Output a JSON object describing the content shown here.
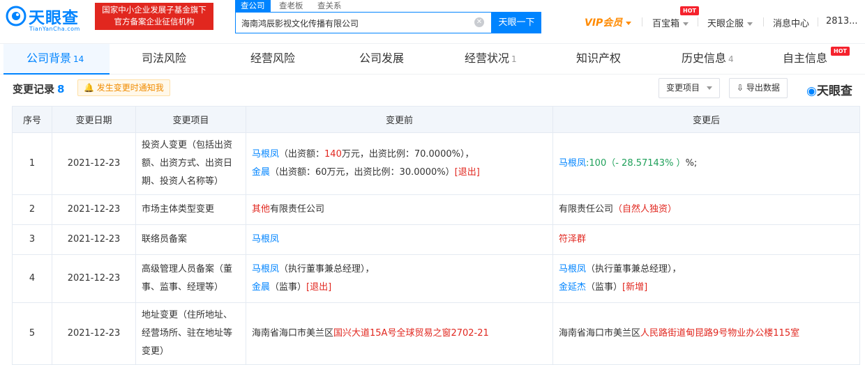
{
  "brand": {
    "name": "天眼查",
    "domain": "TianYanCha.com",
    "accent": "#0084ff"
  },
  "fund_badge": {
    "line1": "国家中小企业发展子基金旗下",
    "line2": "官方备案企业征信机构"
  },
  "search": {
    "tabs": [
      "查公司",
      "查老板",
      "查关系"
    ],
    "value": "海南鸿辰影视文化传播有限公司",
    "button": "天眼一下"
  },
  "nav": {
    "vip": "VIP会员",
    "items": [
      "百宝箱",
      "天眼企服",
      "消息中心",
      "2813..."
    ],
    "hot_label": "HOT"
  },
  "tabs": [
    {
      "label": "公司背景",
      "count": "14"
    },
    {
      "label": "司法风险",
      "count": ""
    },
    {
      "label": "经营风险",
      "count": ""
    },
    {
      "label": "公司发展",
      "count": ""
    },
    {
      "label": "经营状况",
      "count": "1"
    },
    {
      "label": "知识产权",
      "count": ""
    },
    {
      "label": "历史信息",
      "count": "4"
    },
    {
      "label": "自主信息",
      "count": ""
    }
  ],
  "section": {
    "title": "变更记录",
    "count": "8",
    "notify": "发生变更时通知我",
    "filter_button": "变更项目",
    "export_button": "导出数据",
    "brand_mini": "天眼查"
  },
  "table": {
    "headers": [
      "序号",
      "变更日期",
      "变更项目",
      "变更前",
      "变更后"
    ],
    "rows": [
      {
        "no": "1",
        "date": "2021-12-23",
        "item": "投资人变更（包括出资额、出资方式、出资日期、投资人名称等）",
        "before": [
          {
            "name": "马根凤",
            "t1": "（出资额：",
            "hl": "140",
            "t2": "万元，出资比例：70.0000%），",
            "tag": ""
          },
          {
            "name": "金晨",
            "t1": "（出资额：60万元，出资比例：30.0000%）",
            "hl": "",
            "t2": "",
            "tag": "[退出]"
          }
        ],
        "after": {
          "name": "马根凤",
          "t1": ":100（",
          "hl": "- 28.57143% ）",
          "t2": "%;"
        }
      },
      {
        "no": "2",
        "date": "2021-12-23",
        "item": "市场主体类型变更",
        "before": {
          "hl": "其他",
          "rest": "有限责任公司"
        },
        "after": {
          "rest": "有限责任公司",
          "hl": "（自然人独资）"
        }
      },
      {
        "no": "3",
        "date": "2021-12-23",
        "item": "联络员备案",
        "before": {
          "name": "马根凤"
        },
        "after": {
          "name": "符泽群"
        }
      },
      {
        "no": "4",
        "date": "2021-12-23",
        "item": "高级管理人员备案（董事、监事、经理等）",
        "before": [
          {
            "name": "马根凤",
            "role": "（执行董事兼总经理），",
            "tag": ""
          },
          {
            "name": "金晨",
            "role": "（监事）",
            "tag": "[退出]"
          }
        ],
        "after": [
          {
            "name": "马根凤",
            "role": "（执行董事兼总经理），",
            "tag": ""
          },
          {
            "name": "金延杰",
            "role": "（监事）",
            "tag": "[新增]"
          }
        ]
      },
      {
        "no": "5",
        "date": "2021-12-23",
        "item": "地址变更（住所地址、经营场所、驻在地址等变更）",
        "before": {
          "rest": "海南省海口市美兰区",
          "hl": "国兴大道15A号全球贸易之窗2702-21"
        },
        "after": {
          "rest": "海南省海口市美兰区",
          "hl": "人民路街道甸昆路9号物业办公楼115室"
        }
      }
    ]
  }
}
